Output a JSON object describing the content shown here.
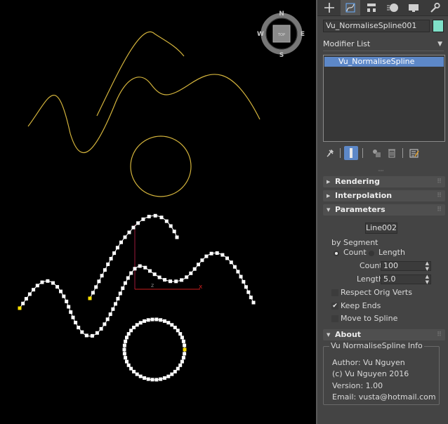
{
  "viewcube": {
    "north": "N",
    "south": "S",
    "east": "E",
    "west": "W",
    "face": "TOP"
  },
  "gizmo": {
    "axis_x": "x",
    "axis_z": "z",
    "color_x": "#c81e1e",
    "color_y": "#9c1a3a"
  },
  "colors": {
    "orig_spline": "#d4b43c",
    "vertex": "#ffffff",
    "first_vertex": "#ffe000",
    "selection": "#5d88c8",
    "object_color": "#7fe0c8"
  },
  "command_panel": {
    "tabs": [
      "create-icon",
      "modify-icon",
      "hierarchy-icon",
      "motion-icon",
      "display-icon",
      "utilities-icon"
    ],
    "object_name": "Vu_NormaliseSpline001",
    "modifier_list_label": "Modifier List",
    "modifier_stack": [
      "Vu_NormaliseSpline"
    ],
    "stack_tools": [
      "pin-stack-icon",
      "show-end-result-icon",
      "make-unique-icon",
      "remove-modifier-icon",
      "configure-modifier-sets-icon"
    ]
  },
  "rollouts": {
    "rendering": "Rendering",
    "interpolation": "Interpolation",
    "parameters": "Parameters",
    "about": "About"
  },
  "parameters": {
    "shape_button": "Line002",
    "by_label": "by Segment",
    "mode_count": "Count",
    "mode_length": "Length",
    "mode_selected": "Count",
    "count_label": "Count",
    "count_value": "100",
    "length_label": "Length",
    "length_value": "5.0",
    "respect_orig_verts": "Respect Orig Verts",
    "respect_orig_verts_checked": false,
    "keep_ends": "Keep Ends",
    "keep_ends_checked": true,
    "keep_ends_mark": "✔",
    "move_to_spline": "Move to Spline",
    "move_to_spline_checked": false
  },
  "about": {
    "group_title": "Vu NormaliseSpline Info",
    "author": "Author: Vu Nguyen",
    "copyright": "(c) Vu Nguyen 2016",
    "version": "Version: 1.00",
    "email": "Email: vusta@hotmail.com"
  }
}
